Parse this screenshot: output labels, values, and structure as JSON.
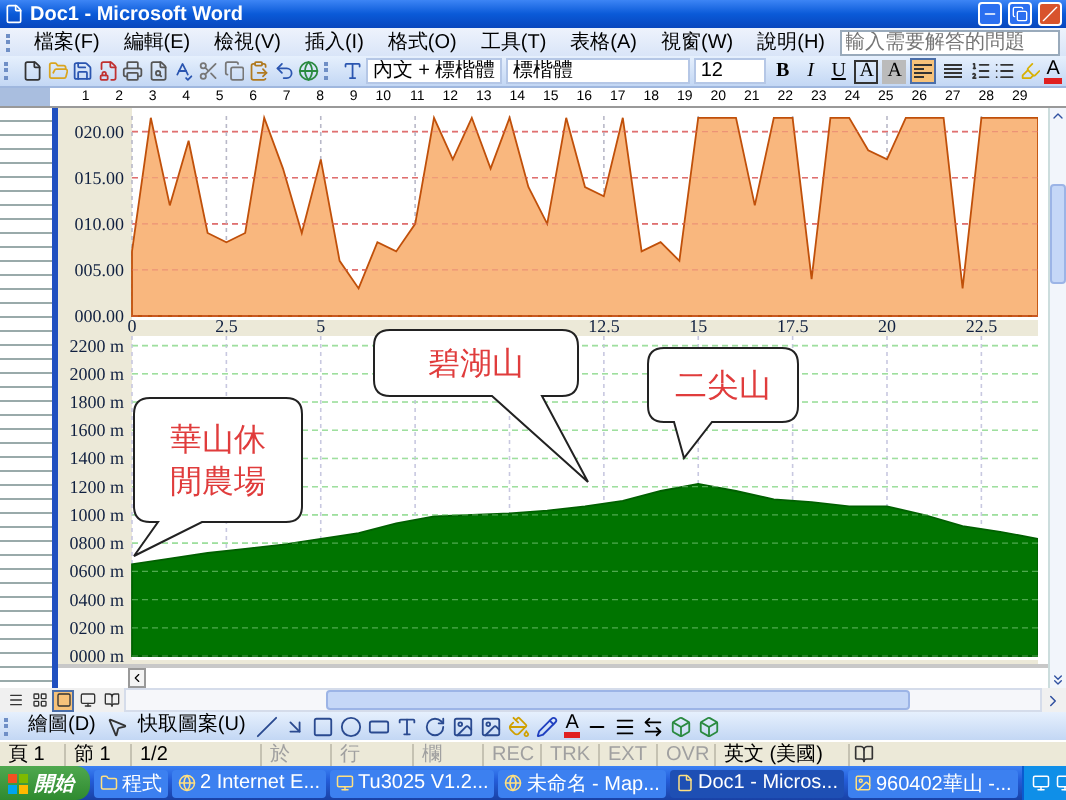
{
  "window": {
    "title": "Doc1 - Microsoft Word"
  },
  "menu": {
    "items": [
      "檔案(F)",
      "編輯(E)",
      "檢視(V)",
      "插入(I)",
      "格式(O)",
      "工具(T)",
      "表格(A)",
      "視窗(W)",
      "說明(H)"
    ],
    "help_box": {
      "placeholder": "輸入需要解答的問題"
    }
  },
  "toolbar": {
    "style": "內文 + 標楷體",
    "font": "標楷體",
    "size": "12",
    "format_buttons": [
      {
        "label": "B",
        "kind": "bold"
      },
      {
        "label": "I",
        "kind": "italic"
      },
      {
        "label": "U",
        "kind": "underline"
      },
      {
        "label": "A",
        "kind": "border"
      },
      {
        "label": "A",
        "kind": "shading"
      }
    ],
    "align_buttons": [
      {
        "kind": "left",
        "selected": true
      },
      {
        "kind": "justify",
        "selected": false
      }
    ],
    "font_color": "A"
  },
  "ruler": {
    "numbers": [
      "1",
      "2",
      "3",
      "4",
      "5",
      "6",
      "7",
      "8",
      "9",
      "10",
      "11",
      "12",
      "13",
      "14",
      "15",
      "16",
      "17",
      "18",
      "19",
      "20",
      "21",
      "22",
      "23",
      "24",
      "25",
      "26",
      "27",
      "28",
      "29"
    ]
  },
  "speed_chart": {
    "chart_data": {
      "type": "area",
      "x": [
        0,
        0.5,
        1,
        1.5,
        2,
        2.5,
        3,
        3.5,
        4,
        4.5,
        5,
        5.5,
        6,
        6.5,
        7,
        7.5,
        8,
        8.5,
        9,
        9.5,
        10,
        10.5,
        11,
        11.5,
        12,
        12.5,
        13,
        13.5,
        14,
        14.5,
        15,
        15.5,
        16,
        16.5,
        17,
        17.5,
        18,
        18.5,
        19,
        19.5,
        20,
        20.5,
        21,
        21.5,
        22,
        22.5,
        23,
        23.5,
        24
      ],
      "values": [
        7,
        21.5,
        12,
        19,
        9,
        8,
        9,
        21.5,
        16,
        9,
        17,
        6,
        3,
        8,
        7,
        10,
        21.5,
        17,
        21.5,
        16,
        21.5,
        14,
        10,
        21.5,
        14,
        13,
        21.5,
        7,
        8,
        6,
        21.5,
        21.5,
        21.5,
        12,
        21.5,
        21.5,
        4,
        21.5,
        21.5,
        18,
        17,
        21.5,
        21.5,
        21.5,
        3,
        21.5,
        21.5,
        21.5,
        21.5
      ],
      "xlim": [
        0,
        24
      ],
      "ylim": [
        0,
        21.7
      ],
      "grid": true,
      "xticks": [
        0,
        2.5,
        5,
        12.5,
        15,
        17.5,
        20,
        22.5
      ],
      "yticks": [
        {
          "value": 0,
          "label": "000.00"
        },
        {
          "value": 5,
          "label": "005.00"
        },
        {
          "value": 10,
          "label": "010.00"
        },
        {
          "value": 15,
          "label": "015.00"
        },
        {
          "value": 20,
          "label": "020.00"
        }
      ]
    }
  },
  "elevation_chart": {
    "chart_data": {
      "type": "area",
      "x": [
        0,
        1,
        2,
        3,
        4,
        5,
        6,
        7,
        8,
        9,
        10,
        11,
        12,
        13,
        14,
        15,
        16,
        17,
        18,
        19,
        20,
        21,
        22,
        23,
        24
      ],
      "values": [
        650,
        690,
        730,
        760,
        790,
        830,
        870,
        940,
        990,
        1000,
        1010,
        1030,
        1060,
        1100,
        1170,
        1220,
        1170,
        1110,
        1090,
        1060,
        1060,
        1000,
        920,
        880,
        830
      ],
      "xlim": [
        0,
        24
      ],
      "ylim": [
        0,
        2268
      ],
      "grid": true,
      "yticks": [
        {
          "value": 0,
          "label": "0000 m"
        },
        {
          "value": 200,
          "label": "0200 m"
        },
        {
          "value": 400,
          "label": "0400 m"
        },
        {
          "value": 600,
          "label": "0600 m"
        },
        {
          "value": 800,
          "label": "0800 m"
        },
        {
          "value": 1000,
          "label": "1000 m"
        },
        {
          "value": 1200,
          "label": "1200 m"
        },
        {
          "value": 1400,
          "label": "1400 m"
        },
        {
          "value": 1600,
          "label": "1600 m"
        },
        {
          "value": 1800,
          "label": "1800 m"
        },
        {
          "value": 2000,
          "label": "2000 m"
        },
        {
          "value": 2200,
          "label": "2200 m"
        }
      ]
    },
    "callouts": [
      "華山休閒農場",
      "碧湖山",
      "二尖山"
    ]
  },
  "view_buttons": [
    {
      "selected": false
    },
    {
      "selected": false
    },
    {
      "selected": true
    },
    {
      "selected": false
    },
    {
      "selected": false
    }
  ],
  "drawing_toolbar": {
    "draw_menu": "繪圖(D)",
    "autoshapes_menu": "快取圖案(U)",
    "font_color": "A"
  },
  "status_bar": {
    "items": [
      {
        "text": "頁 1",
        "disabled": false
      },
      {
        "text": "節 1",
        "disabled": false
      },
      {
        "text": "1/2",
        "disabled": false
      },
      {
        "text": "於",
        "disabled": true
      },
      {
        "text": "行",
        "disabled": true
      },
      {
        "text": "欄",
        "disabled": true
      },
      {
        "text": "REC",
        "disabled": true
      },
      {
        "text": "TRK",
        "disabled": true
      },
      {
        "text": "EXT",
        "disabled": true
      },
      {
        "text": "OVR",
        "disabled": true
      },
      {
        "text": "英文 (美國)",
        "disabled": false
      }
    ]
  },
  "taskbar": {
    "start": "開始",
    "items": [
      {
        "label": "程式",
        "selected": false
      },
      {
        "label": "2 Internet E...",
        "selected": false
      },
      {
        "label": "Tu3025 V1.2...",
        "selected": false
      },
      {
        "label": "未命名 - Map...",
        "selected": false
      },
      {
        "label": "Doc1 - Micros...",
        "selected": true
      },
      {
        "label": "960402華山 -...",
        "selected": false
      }
    ]
  }
}
